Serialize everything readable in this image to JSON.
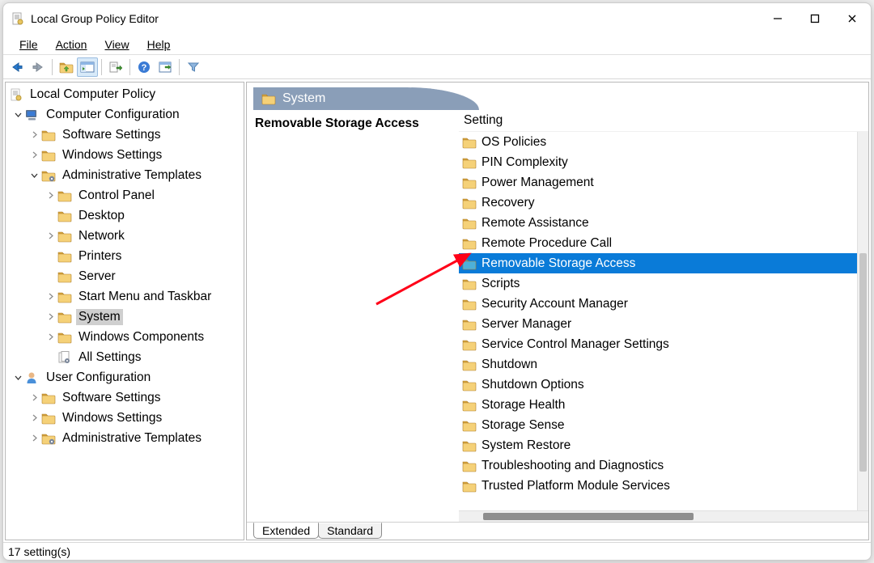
{
  "window": {
    "title": "Local Group Policy Editor"
  },
  "menu": {
    "file": "File",
    "action": "Action",
    "view": "View",
    "help": "Help"
  },
  "tree": {
    "root": "Local Computer Policy",
    "comp_config": "Computer Configuration",
    "comp_software": "Software Settings",
    "comp_windows": "Windows Settings",
    "comp_admin": "Administrative Templates",
    "at_control_panel": "Control Panel",
    "at_desktop": "Desktop",
    "at_network": "Network",
    "at_printers": "Printers",
    "at_server": "Server",
    "at_startmenu": "Start Menu and Taskbar",
    "at_system": "System",
    "at_wincomp": "Windows Components",
    "at_allsettings": "All Settings",
    "user_config": "User Configuration",
    "user_software": "Software Settings",
    "user_windows": "Windows Settings",
    "user_admin": "Administrative Templates"
  },
  "right": {
    "header_title": "System",
    "page_title": "Removable Storage Access",
    "column_header": "Setting",
    "items": [
      "OS Policies",
      "PIN Complexity",
      "Power Management",
      "Recovery",
      "Remote Assistance",
      "Remote Procedure Call",
      "Removable Storage Access",
      "Scripts",
      "Security Account Manager",
      "Server Manager",
      "Service Control Manager Settings",
      "Shutdown",
      "Shutdown Options",
      "Storage Health",
      "Storage Sense",
      "System Restore",
      "Troubleshooting and Diagnostics",
      "Trusted Platform Module Services"
    ],
    "selected_index": 6,
    "tabs": {
      "extended": "Extended",
      "standard": "Standard"
    }
  },
  "status": {
    "text": "17 setting(s)"
  }
}
